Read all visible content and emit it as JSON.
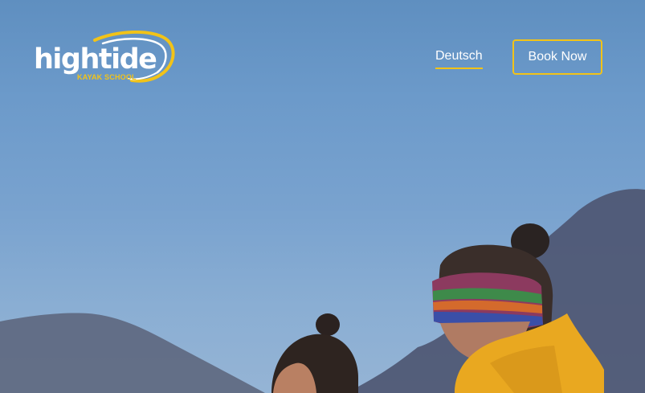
{
  "brand": {
    "name": "hightide",
    "tagline": "KAYAK SCHOOL",
    "logo_icon": "swoosh-logo-icon"
  },
  "nav": {
    "language_link": "Deutsch",
    "book_button": "Book Now"
  },
  "colors": {
    "accent": "#f2c318",
    "sky": "#6c9aca",
    "text": "#ffffff"
  }
}
